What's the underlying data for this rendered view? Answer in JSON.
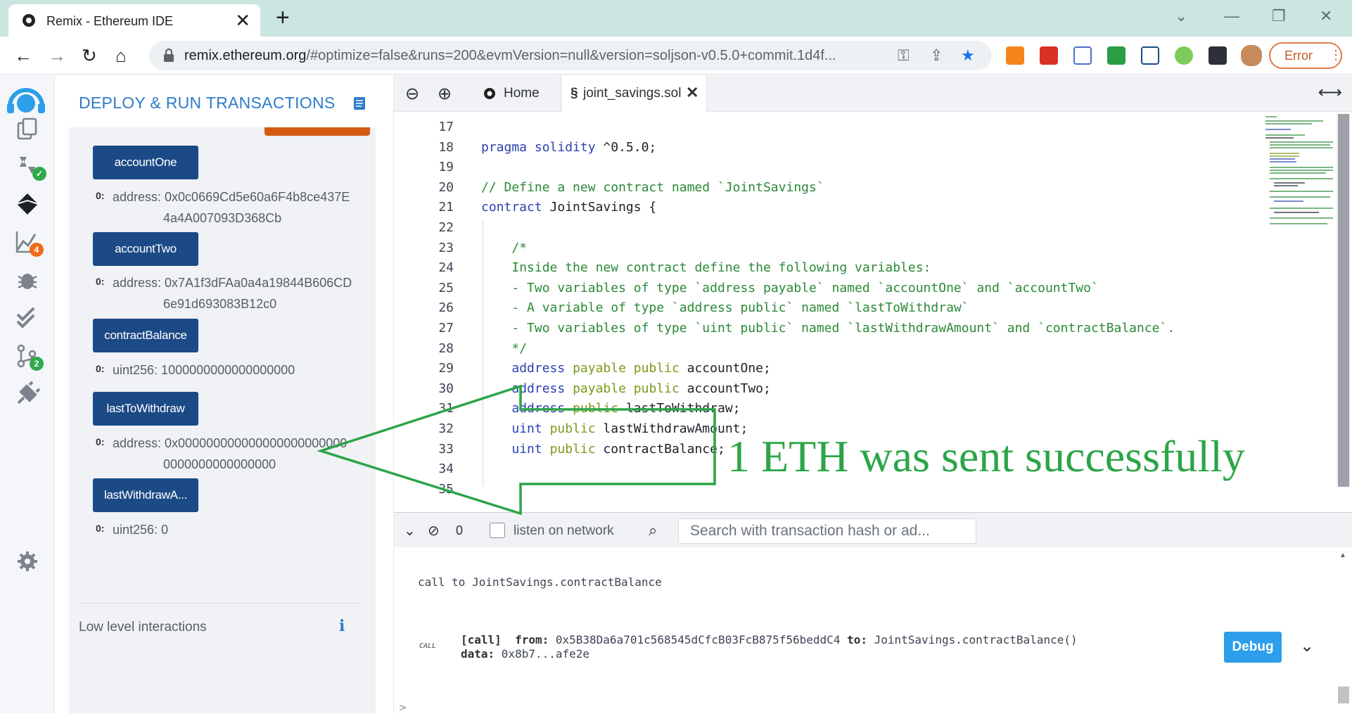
{
  "browser": {
    "tab_title": "Remix - Ethereum IDE",
    "tab_close": "✕",
    "new_tab": "+",
    "url_host": "remix.ethereum.org",
    "url_path": "/#optimize=false&runs=200&evmVersion=null&version=soljson-v0.5.0+commit.1d4f...",
    "error_label": "Error",
    "nav": {
      "back": "←",
      "forward": "→",
      "reload": "↻",
      "home": "⌂"
    },
    "window": {
      "minimize": "—",
      "restore": "❐",
      "close": "✕",
      "menu": "⌄"
    }
  },
  "rail": {
    "icons": [
      "remix-logo-icon",
      "file-explorer-icon",
      "solidity-compiler-icon",
      "deploy-run-icon",
      "analysis-icon",
      "debugger-icon",
      "unit-test-icon",
      "git-icon",
      "plugin-manager-icon",
      "settings-icon"
    ],
    "analysis_badge": "4",
    "git_badge": "2"
  },
  "panel": {
    "title": "DEPLOY & RUN TRANSACTIONS",
    "functions": [
      {
        "label": "accountOne",
        "index": "0:",
        "value_lines": [
          "address: 0x0c0669Cd5e60a6F4b8ce437E",
          "4a4A007093D368Cb"
        ]
      },
      {
        "label": "accountTwo",
        "index": "0:",
        "value_lines": [
          "address: 0x7A1f3dFAa0a4a19844B606CD",
          "6e91d693083B12c0"
        ]
      },
      {
        "label": "contractBalance",
        "index": "0:",
        "value_lines": [
          "uint256: 1000000000000000000"
        ]
      },
      {
        "label": "lastToWithdraw",
        "index": "0:",
        "value_lines": [
          "address: 0x000000000000000000000000",
          "0000000000000000"
        ]
      },
      {
        "label": "lastWithdrawA...",
        "index": "0:",
        "value_lines": [
          "uint256: 0"
        ]
      }
    ],
    "low_level": "Low level interactions",
    "info_icon": "i"
  },
  "editor": {
    "tabs": [
      {
        "label": "Home",
        "icon": "remix-logo-icon"
      },
      {
        "label": "joint_savings.sol",
        "icon": "solidity-file-icon",
        "close": "✕"
      }
    ],
    "lines": [
      {
        "n": "17",
        "html": ""
      },
      {
        "n": "18",
        "html": "<span class=\"kw\">pragma</span> <span class=\"kw\">solidity</span> ^0.5.0;"
      },
      {
        "n": "19",
        "html": ""
      },
      {
        "n": "20",
        "html": "<span class=\"cm\">// Define a new contract named `JointSavings`</span>"
      },
      {
        "n": "21",
        "html": "<span class=\"kw\">contract</span> JointSavings {"
      },
      {
        "n": "22",
        "html": ""
      },
      {
        "n": "23",
        "html": "    <span class=\"cm\">/*</span>"
      },
      {
        "n": "24",
        "html": "    <span class=\"cm\">Inside the new contract define the following variables:</span>"
      },
      {
        "n": "25",
        "html": "    <span class=\"cm\">- Two variables of type `address payable` named `accountOne` and `accountTwo`</span>"
      },
      {
        "n": "26",
        "html": "    <span class=\"cm\">- A variable of type `address public` named `lastToWithdraw`</span>"
      },
      {
        "n": "27",
        "html": "    <span class=\"cm\">- Two variables of type `uint public` named `lastWithdrawAmount` and `contractBalance`.</span>"
      },
      {
        "n": "28",
        "html": "    <span class=\"cm\">*/</span>"
      },
      {
        "n": "29",
        "html": "    <span class=\"kw\">address</span> <span class=\"vis\">payable</span> <span class=\"vis\">public</span> accountOne;"
      },
      {
        "n": "30",
        "html": "    <span class=\"kw\">address</span> <span class=\"vis\">payable</span> <span class=\"vis\">public</span> accountTwo;"
      },
      {
        "n": "31",
        "html": "    <span class=\"kw\">address</span> <span class=\"vis\">public</span> lastToWithdraw;"
      },
      {
        "n": "32",
        "html": "    <span class=\"kw\">uint</span> <span class=\"vis\">public</span> lastWithdrawAmount;"
      },
      {
        "n": "33",
        "html": "    <span class=\"kw\">uint</span> <span class=\"vis\">public</span> contractBalance;"
      },
      {
        "n": "34",
        "html": ""
      },
      {
        "n": "35",
        "html": ""
      }
    ]
  },
  "terminal": {
    "count": "0",
    "listen_label": "listen on network",
    "search_placeholder": "Search with transaction hash or ad...",
    "call_to": "call to JointSavings.contractBalance",
    "tag": "CALL",
    "from_label": "[call]  from:",
    "from_value": " 0x5B38Da6a701c568545dCfcB03FcB875f56beddC4 ",
    "to_label": "to:",
    "to_value": " JointSavings.contractBalance()",
    "data_label": "data:",
    "data_value": " 0x8b7...afe2e",
    "debug_label": "Debug",
    "prompt": ">"
  },
  "annotation": {
    "text": "1 ETH was sent successfully",
    "color": "#2ba548"
  }
}
